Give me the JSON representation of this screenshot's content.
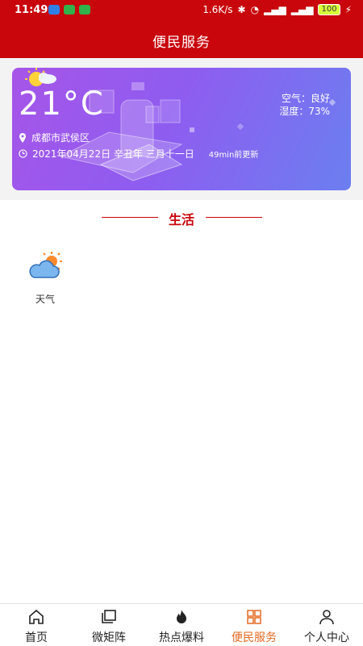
{
  "status_bar": {
    "time": "11:49",
    "net_speed": "1.6K/s",
    "battery": "100",
    "colors": {
      "bar": "#c8060c",
      "battery": "#d8ff3a"
    }
  },
  "header": {
    "title": "便民服务"
  },
  "weather_card": {
    "temperature": "21°C",
    "air_quality": "空气：良好",
    "humidity": "湿度：73%",
    "location": "成都市武侯区",
    "date": "2021年04月22日 辛丑年 三月十一日",
    "updated": "49min前更新",
    "icons": {
      "location": "location-pin-icon",
      "clock": "clock-icon",
      "weather": "sun-cloud-icon"
    }
  },
  "section": {
    "title": "生活",
    "accent_color": "#c8060c"
  },
  "services": [
    {
      "label": "天气",
      "icon": "cloud-sun-icon"
    }
  ],
  "bottom_nav": {
    "items": [
      {
        "label": "首页",
        "icon": "home-icon"
      },
      {
        "label": "微矩阵",
        "icon": "matrix-icon"
      },
      {
        "label": "热点爆料",
        "icon": "fire-icon"
      },
      {
        "label": "便民服务",
        "icon": "grid-icon"
      },
      {
        "label": "个人中心",
        "icon": "person-icon"
      }
    ],
    "active_index": 3,
    "active_color": "#e46a22"
  }
}
